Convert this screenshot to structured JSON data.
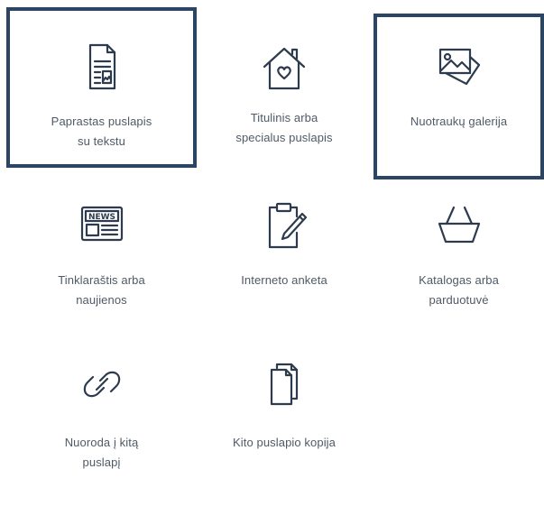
{
  "page_types": {
    "tiles": [
      {
        "line1": "Paprastas puslapis",
        "line2": "su tekstu",
        "icon": "document-with-image-icon",
        "selected": true
      },
      {
        "line1": "Titulinis arba",
        "line2": "specialus puslapis",
        "icon": "house-heart-icon",
        "selected": false
      },
      {
        "line1": "Nuotraukų galerija",
        "line2": "",
        "icon": "photo-gallery-icon",
        "selected": true
      },
      {
        "line1": "Tinklaraštis arba",
        "line2": "naujienos",
        "icon": "newspaper-icon",
        "selected": false
      },
      {
        "line1": "Interneto anketa",
        "line2": "",
        "icon": "clipboard-pencil-icon",
        "selected": false
      },
      {
        "line1": "Katalogas arba",
        "line2": "parduotuvė",
        "icon": "shopping-basket-icon",
        "selected": false
      },
      {
        "line1": "Nuoroda į kitą",
        "line2": "puslapį",
        "icon": "link-icon",
        "selected": false
      },
      {
        "line1": "Kito puslapio kopija",
        "line2": "",
        "icon": "copy-pages-icon",
        "selected": false
      }
    ]
  },
  "colors": {
    "selection_border": "#2b4664",
    "icon_stroke": "#2e3b4e",
    "label_text": "#4f5a66"
  }
}
